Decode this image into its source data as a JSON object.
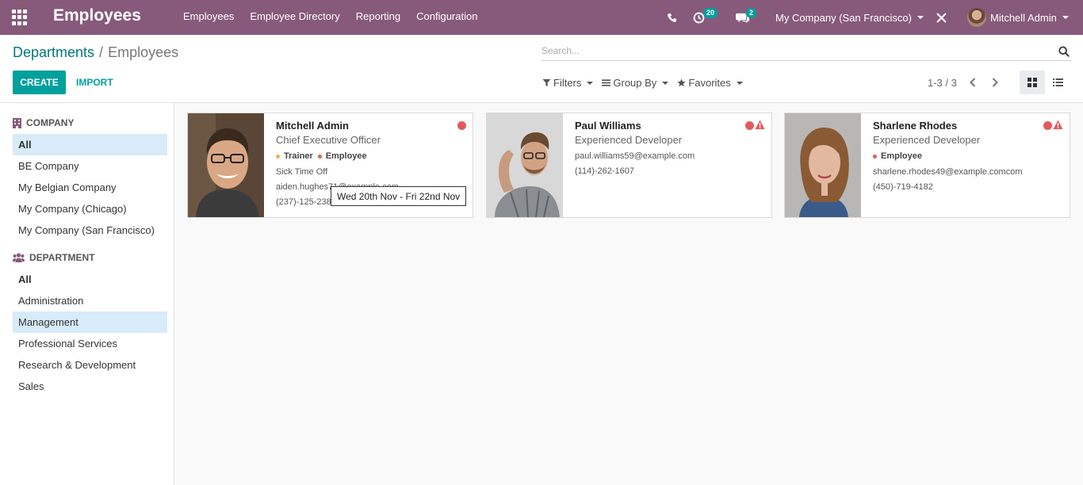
{
  "navbar": {
    "app_title": "Employees",
    "menu": [
      "Employees",
      "Employee Directory",
      "Reporting",
      "Configuration"
    ],
    "activity_count": "20",
    "messages_count": "2",
    "company_switcher": "My Company (San Francisco)",
    "user_name": "Mitchell Admin",
    "bg_color": "#875a7b"
  },
  "breadcrumb": {
    "parent": "Departments",
    "separator": "/",
    "current": "Employees"
  },
  "search": {
    "placeholder": "Search..."
  },
  "actions": {
    "create": "CREATE",
    "import": "IMPORT"
  },
  "filters": {
    "filters": "Filters",
    "group_by": "Group By",
    "favorites": "Favorites"
  },
  "pager": {
    "value": "1-3 / 3"
  },
  "sidebar": {
    "company_title": "COMPANY",
    "companies": [
      "All",
      "BE Company",
      "My Belgian Company",
      "My Company (Chicago)",
      "My Company (San Francisco)"
    ],
    "department_title": "DEPARTMENT",
    "departments": [
      "All",
      "Administration",
      "Management",
      "Professional Services",
      "Research & Development",
      "Sales"
    ]
  },
  "employees": [
    {
      "name": "Mitchell Admin",
      "job": "Chief Executive Officer",
      "tags": [
        "Trainer",
        "Employee"
      ],
      "tag_colors": [
        "#f0ad4e",
        "#e15b5b"
      ],
      "extra": "Sick Time Off",
      "email": "aiden.hughes71@example.com",
      "phone": "(237)-125-2389"
    },
    {
      "name": "Paul Williams",
      "job": "Experienced Developer",
      "email": "paul.williams59@example.com",
      "phone": "(114)-262-1607"
    },
    {
      "name": "Sharlene Rhodes",
      "job": "Experienced Developer",
      "tags": [
        "Employee"
      ],
      "tag_colors": [
        "#e15b5b"
      ],
      "email": "sharlene.rhodes49@example.comcom",
      "phone": "(450)-719-4182"
    }
  ],
  "tooltip": "Wed 20th Nov - Fri 22nd Nov",
  "colors": {
    "accent": "#00a09d",
    "link": "#00767a",
    "status_red": "#e15b5b",
    "selected_bg": "#d8ebf8"
  }
}
